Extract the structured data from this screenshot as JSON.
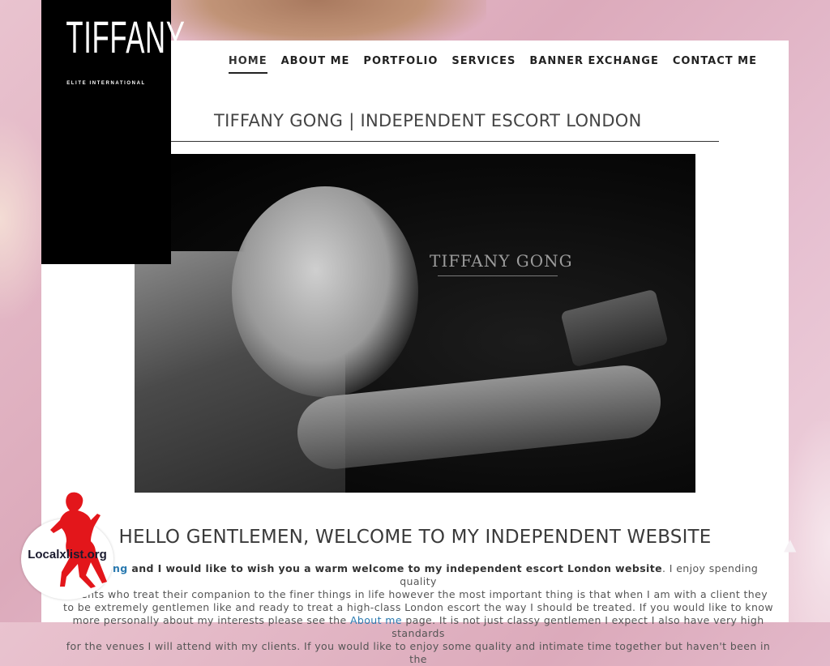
{
  "logo": {
    "main": "TIFFANY",
    "sub": "ELITE INTERNATIONAL"
  },
  "nav": {
    "items": [
      {
        "label": "HOME",
        "active": true
      },
      {
        "label": "ABOUT ME",
        "active": false
      },
      {
        "label": "PORTFOLIO",
        "active": false
      },
      {
        "label": "SERVICES",
        "active": false
      },
      {
        "label": "BANNER EXCHANGE",
        "active": false
      },
      {
        "label": "CONTACT ME",
        "active": false
      }
    ]
  },
  "page": {
    "title": "TIFFANY GONG | INDEPENDENT ESCORT LONDON",
    "hero_watermark": "TIFFANY GONG",
    "welcome_heading": "HELLO GENTLEMEN, WELCOME TO MY INDEPENDENT WEBSITE"
  },
  "intro": {
    "name_link": "ny Gong",
    "bold_text": " and I would like to wish you a warm welcome to my independent escort London website",
    "text_1": ". I enjoy spending quality",
    "text_2": "clients who treat their companion to the finer things in life however the most important thing is that when I am with a client they",
    "text_3": "to be extremely gentlemen like and ready to treat a high-class London escort the way I should be treated. If you would like to know",
    "text_4": "more personally about my interests please see the ",
    "about_link": "About me",
    "text_5": " page. It is not just classy gentlemen I expect I also have very high standards",
    "text_6": "for the venues I will attend with my clients. If you would like to enjoy some quality and intimate time together but haven't been in the"
  },
  "badge": {
    "text": "Localxlist.org"
  },
  "colors": {
    "link": "#2a7ab0",
    "badge_red": "#e3161b",
    "nav_text": "#222222"
  }
}
